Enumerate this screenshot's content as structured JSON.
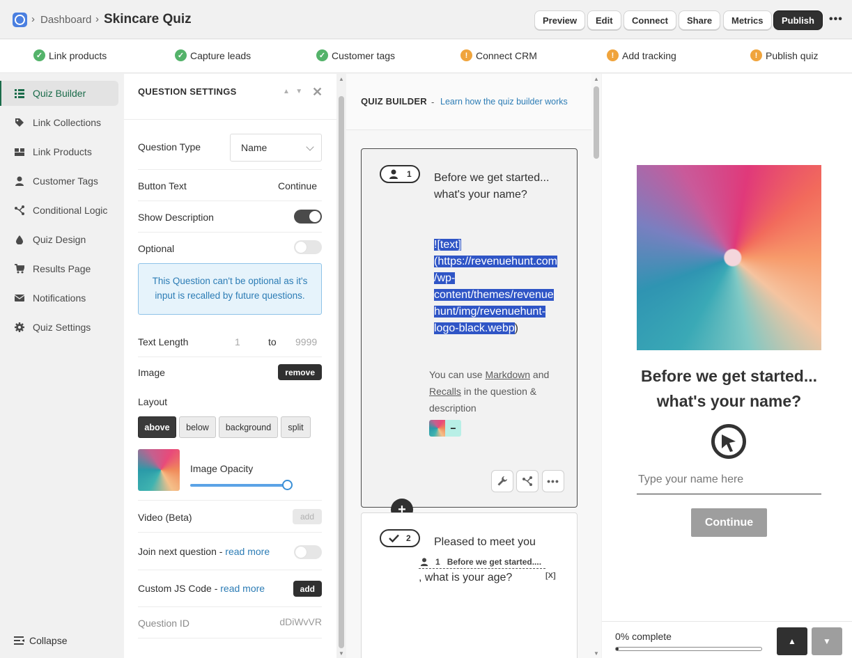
{
  "header": {
    "breadcrumb_parent": "Dashboard",
    "title": "Skincare Quiz",
    "buttons": {
      "preview": "Preview",
      "edit": "Edit",
      "connect": "Connect",
      "share": "Share",
      "metrics": "Metrics",
      "publish": "Publish"
    }
  },
  "checklist": [
    {
      "label": "Link products",
      "status": "done"
    },
    {
      "label": "Capture leads",
      "status": "done"
    },
    {
      "label": "Customer tags",
      "status": "done"
    },
    {
      "label": "Connect CRM",
      "status": "warning"
    },
    {
      "label": "Add tracking",
      "status": "warning"
    },
    {
      "label": "Publish quiz",
      "status": "warning"
    }
  ],
  "sidebar": {
    "items": [
      {
        "label": "Quiz Builder",
        "icon": "list-icon",
        "active": true
      },
      {
        "label": "Link Collections",
        "icon": "tag-icon"
      },
      {
        "label": "Link Products",
        "icon": "products-icon"
      },
      {
        "label": "Customer Tags",
        "icon": "person-icon"
      },
      {
        "label": "Conditional Logic",
        "icon": "branch-icon"
      },
      {
        "label": "Quiz Design",
        "icon": "drop-icon"
      },
      {
        "label": "Results Page",
        "icon": "cart-icon"
      },
      {
        "label": "Notifications",
        "icon": "envelope-icon"
      },
      {
        "label": "Quiz Settings",
        "icon": "gear-icon"
      }
    ],
    "collapse_label": "Collapse"
  },
  "question_settings": {
    "title": "QUESTION SETTINGS",
    "question_type_label": "Question Type",
    "question_type_value": "Name",
    "button_text_label": "Button Text",
    "button_text_value": "Continue",
    "show_description_label": "Show Description",
    "show_description_on": true,
    "optional_label": "Optional",
    "optional_on": false,
    "optional_info": "This Question can't be optional as it's input is recalled by future questions.",
    "text_length_label": "Text Length",
    "text_length_min": "1",
    "text_length_to": "to",
    "text_length_max": "9999",
    "image_label": "Image",
    "image_remove": "remove",
    "layout_label": "Layout",
    "layout_options": [
      "above",
      "below",
      "background",
      "split"
    ],
    "layout_selected": "above",
    "image_opacity_label": "Image Opacity",
    "image_opacity_value": 1.0,
    "video_label": "Video (Beta)",
    "video_add": "add",
    "join_next_label": "Join next question - ",
    "join_next_link": "read more",
    "join_next_on": false,
    "custom_js_label": "Custom JS Code - ",
    "custom_js_link": "read more",
    "custom_js_add": "add",
    "question_id_label": "Question ID",
    "question_id_value": "dDiWvVR"
  },
  "builder": {
    "title": "QUIZ BUILDER",
    "dash": "-",
    "help_link": "Learn how the quiz builder works",
    "questions": [
      {
        "number": "1",
        "icon": "person-icon",
        "text_line1": "Before we get started...",
        "text_line2": "what's your name?",
        "selected_lines": [
          "![text]",
          "(https://revenuehunt.com",
          "/wp-",
          "content/themes/revenue",
          "hunt/img/revenuehunt-",
          "logo-black.webp",
          ")"
        ],
        "hint_pre": "You can use ",
        "hint_markdown": "Markdown",
        "hint_mid": " and ",
        "hint_recalls": "Recalls",
        "hint_post": " in the question & description",
        "thumb_remove": "−"
      },
      {
        "number": "2",
        "icon": "check-icon",
        "text_line1": "Pleased to meet you",
        "recall_number": "1",
        "recall_text": "Before we get started....",
        "recall_close": "[X]",
        "text_line2": ", what is your age?"
      }
    ]
  },
  "preview": {
    "title": "Before we get started... what's your name?",
    "input_placeholder": "Type your name here",
    "continue_label": "Continue",
    "progress_label": "0% complete",
    "progress_value": 0.02
  },
  "colors": {
    "accent_green": "#1a6b4a",
    "done": "#54b36a",
    "warning": "#f0a43c",
    "link": "#2c7cb5",
    "selection": "#2f55c6"
  }
}
